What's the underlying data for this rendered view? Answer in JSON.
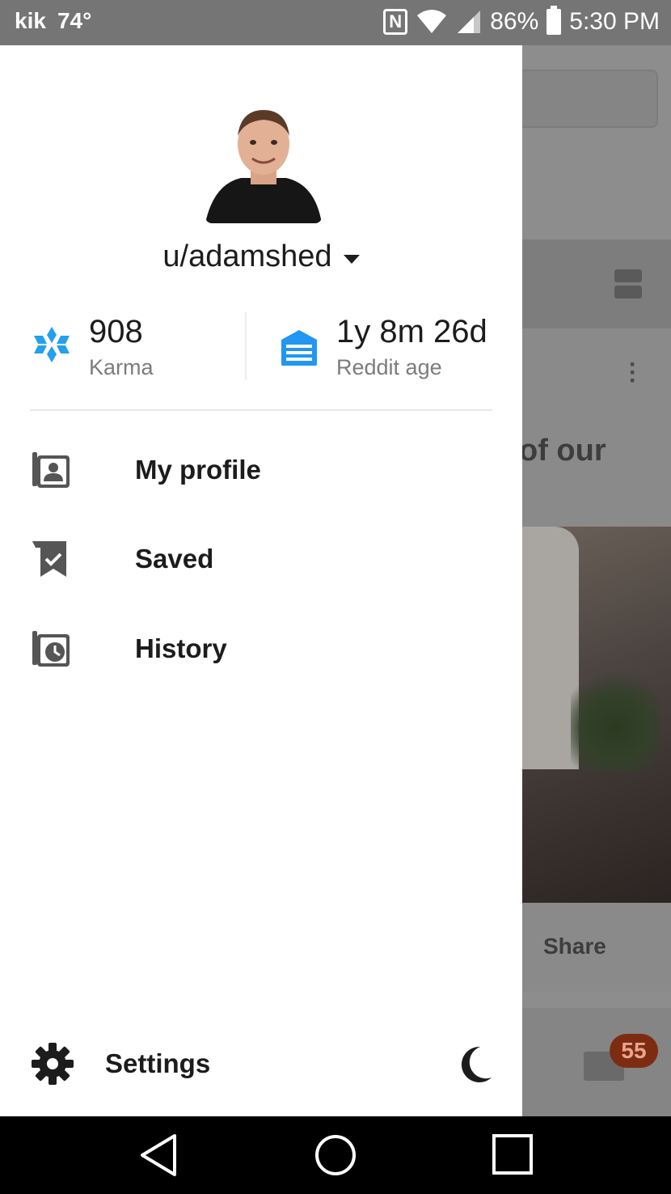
{
  "status_bar": {
    "app_icon": "kik",
    "temperature": "74°",
    "nfc_icon": "N",
    "battery": "86%",
    "time": "5:30 PM"
  },
  "drawer": {
    "username": "u/adamshed",
    "karma": {
      "value": "908",
      "label": "Karma"
    },
    "reddit_age": {
      "value": "1y 8m 26d",
      "label": "Reddit age"
    },
    "menu": [
      {
        "label": "My profile",
        "icon": "profile-icon"
      },
      {
        "label": "Saved",
        "icon": "saved-icon"
      },
      {
        "label": "History",
        "icon": "history-icon"
      }
    ],
    "settings_label": "Settings"
  },
  "background_app": {
    "post_title_fragment": "of our",
    "share_label": "Share",
    "inbox_badge": "55"
  },
  "colors": {
    "status_bar": "#757575",
    "accent_blue": "#2196f3",
    "karma_blue": "#24a0ed",
    "text_dark": "#1c1c1c",
    "text_muted": "#7c7c7c"
  }
}
